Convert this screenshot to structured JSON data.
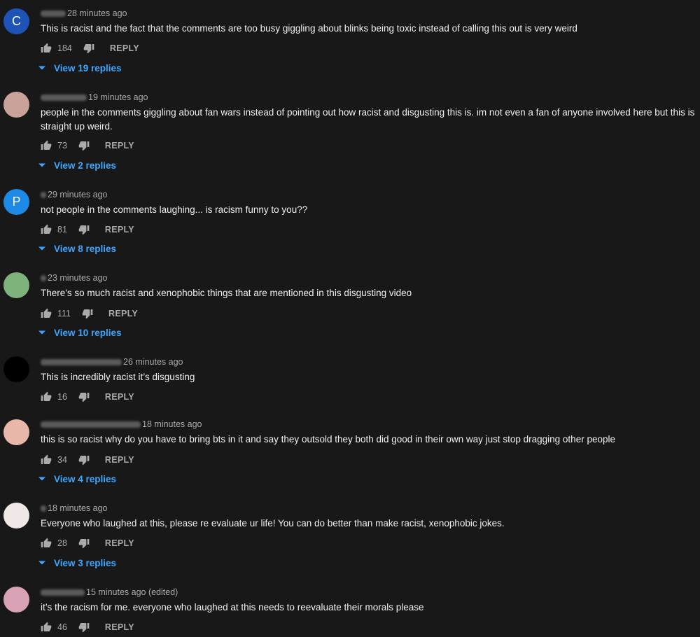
{
  "comments": [
    {
      "avatar_letter": "C",
      "avatar_color": "#1e54b7",
      "time": "28 minutes ago",
      "text": "This is racist and the fact that the comments are too busy giggling about blinks being toxic instead of calling this out is very weird",
      "likes": "184",
      "reply_label": "REPLY",
      "view_replies": "View 19 replies"
    },
    {
      "avatar_letter": "",
      "avatar_color": "#c9a39a",
      "time": "19 minutes ago",
      "text": "people in the comments giggling about fan wars instead of pointing out how racist and disgusting this is. im not even a fan of anyone involved here but this is straight up weird.",
      "likes": "73",
      "reply_label": "REPLY",
      "view_replies": "View 2 replies"
    },
    {
      "avatar_letter": "P",
      "avatar_color": "#1e88e5",
      "time": "29 minutes ago",
      "text": "not people in the comments laughing... is racism funny to you??",
      "likes": "81",
      "reply_label": "REPLY",
      "view_replies": "View 8 replies"
    },
    {
      "avatar_letter": "",
      "avatar_color": "#7fb37c",
      "time": "23 minutes ago",
      "text": "There's so much racist and xenophobic things that are mentioned in this disgusting video",
      "likes": "111",
      "reply_label": "REPLY",
      "view_replies": "View 10 replies"
    },
    {
      "avatar_letter": "",
      "avatar_color": "#000000",
      "time": "26 minutes ago",
      "text": "This is incredibly racist it’s disgusting",
      "likes": "16",
      "reply_label": "REPLY",
      "view_replies": ""
    },
    {
      "avatar_letter": "",
      "avatar_color": "#e8b7a9",
      "time": "18 minutes ago",
      "text": "this is so racist why do you have to bring bts in it and say they outsold they both did good in their own way just stop dragging other people",
      "likes": "34",
      "reply_label": "REPLY",
      "view_replies": "View 4 replies"
    },
    {
      "avatar_letter": "",
      "avatar_color": "#f0e8e6",
      "time": "18 minutes ago",
      "text": "Everyone who laughed at this, please re evaluate ur life! You can do better than make racist, xenophobic jokes.",
      "likes": "28",
      "reply_label": "REPLY",
      "view_replies": "View 3 replies"
    },
    {
      "avatar_letter": "",
      "avatar_color": "#d9a2b7",
      "time": "15 minutes ago (edited)",
      "text": "it’s the racism for me. everyone who laughed at this needs to reevaluate their morals please",
      "likes": "46",
      "reply_label": "REPLY",
      "view_replies": ""
    }
  ]
}
